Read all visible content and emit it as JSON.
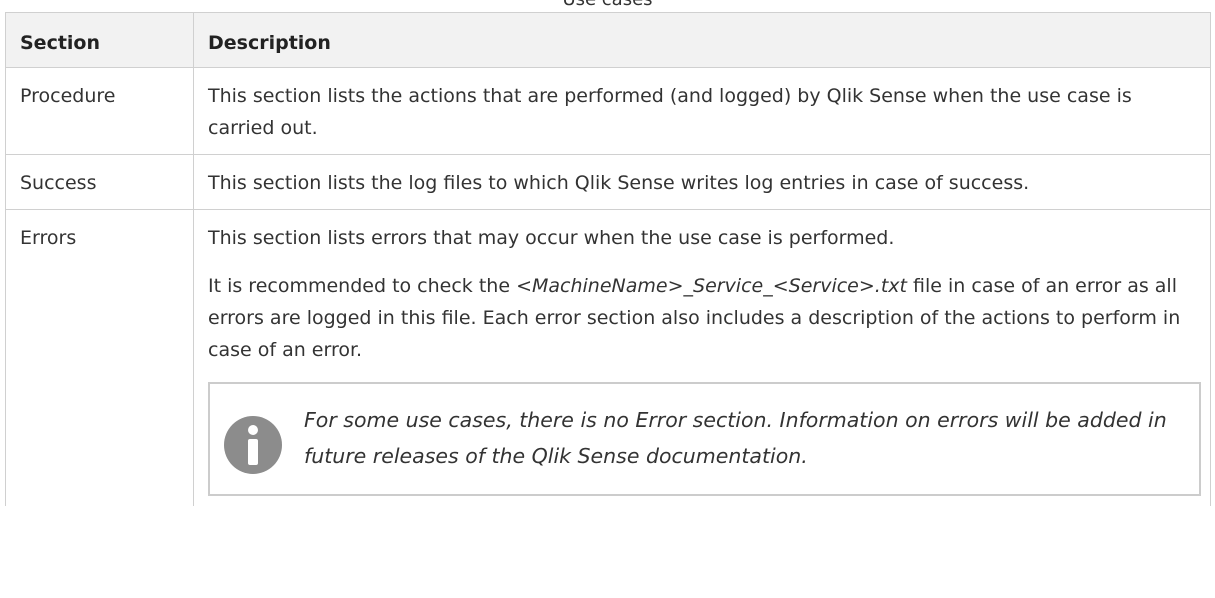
{
  "caption": "Use cases",
  "table": {
    "headers": [
      "Section",
      "Description"
    ],
    "rows": [
      {
        "section": "Procedure",
        "description": "This section lists the actions that are performed (and logged) by Qlik Sense when the use case is carried out."
      },
      {
        "section": "Success",
        "description": "This section lists the log files to which Qlik Sense writes log entries in case of success."
      },
      {
        "section": "Errors",
        "description": "This section lists errors that may occur when the use case is performed.",
        "recommend_before": "It is recommended to check the",
        "recommend_file": "<MachineName>_Service_<Service>.txt",
        "recommend_after": "file in case of an error as all errors are logged in this file. Each error section also includes a description of the actions to perform in case of an error.",
        "note": "For some use cases, there is no Error section. Information on errors will be added in future releases of the Qlik Sense documentation."
      }
    ]
  },
  "colors": {
    "header_bg": "#f2f2f2",
    "border": "#d0d0d0",
    "note_border": "#cccccc",
    "info_icon": "#8c8c8c",
    "text": "#333333"
  },
  "icons": {
    "note": "info-icon"
  }
}
